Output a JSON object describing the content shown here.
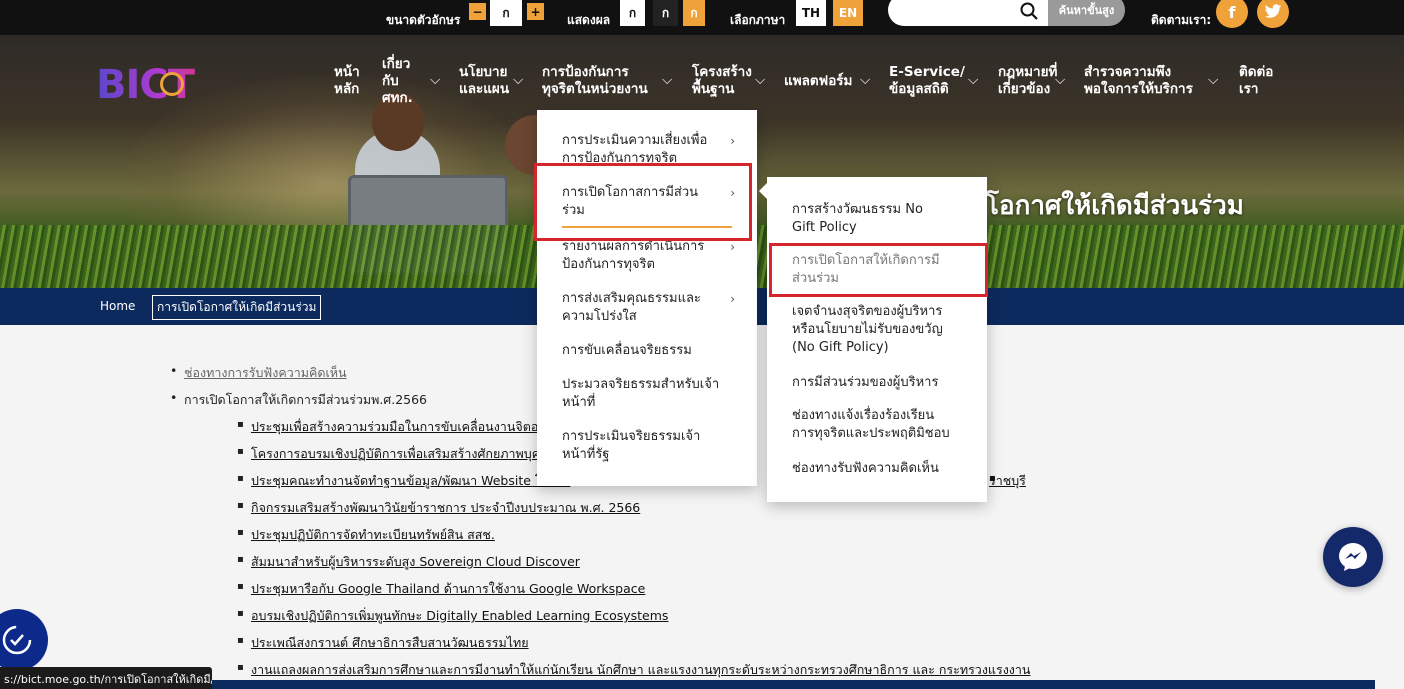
{
  "topbar": {
    "font_size_label": "ขนาดตัวอักษร",
    "font_minus": "−",
    "font_normal": "ก",
    "font_plus": "+",
    "display_label": "แสดงผล",
    "display_options": [
      "ก",
      "ก",
      "ก"
    ],
    "language_label": "เลือกภาษา",
    "lang_th": "TH",
    "lang_en": "EN",
    "search_placeholder": "",
    "advanced_search": "ค้นหาขั้นสูง",
    "follow_label": "ติดตามเรา:"
  },
  "logo": {
    "text": "BICT"
  },
  "nav": {
    "home": [
      "หน้า",
      "หลัก"
    ],
    "about": [
      "เกี่ยว",
      "กับ",
      "ศทก."
    ],
    "policy": [
      "นโยบาย",
      "และแผน"
    ],
    "anticorruption": [
      "การป้องกันการ",
      "ทุจริตในหน่วยงาน"
    ],
    "infrastructure": [
      "โครงสร้าง",
      "พื้นฐาน"
    ],
    "platform": [
      "แพลตฟอร์ม"
    ],
    "eservice": [
      "E-Service/",
      "ข้อมูลสถิติ"
    ],
    "law": [
      "กฎหมายที่",
      "เกี่ยวข้อง"
    ],
    "survey": [
      "สำรวจความพึง",
      "พอใจการให้บริการ"
    ],
    "contact": [
      "ติดต่อ",
      "เรา"
    ]
  },
  "hero": {
    "title": "โอกาศให้เกิดมีส่วนร่วม"
  },
  "breadcrumb": {
    "home": "Home",
    "current": "การเปิดโอกาศให้เกิดมีส่วนร่วม"
  },
  "dropdown1": {
    "items": [
      [
        "การประเมินความเสี่ยงเพื่อ",
        "การป้องกันการทุจริต"
      ],
      [
        "การเปิดโอกาสการมีส่วน",
        "ร่วม"
      ],
      [
        "รายงานผลการดำเนินการ",
        "ป้องกันการทุจริต"
      ],
      [
        "การส่งเสริมคุณธรรมและ",
        "ความโปร่งใส"
      ],
      [
        "การขับเคลื่อนจริยธรรม"
      ],
      [
        "ประมวลจริยธรรมสำหรับเจ้า",
        "หน้าที่"
      ],
      [
        "การประเมินจริยธรรมเจ้า",
        "หน้าที่รัฐ"
      ]
    ]
  },
  "dropdown2": {
    "items": [
      [
        "การสร้างวัฒนธรรม No",
        "Gift Policy"
      ],
      [
        "การเปิดโอกาสให้เกิดการมี",
        "ส่วนร่วม"
      ],
      [
        "เจตจำนงสุจริตของผู้บริหาร",
        "หรือนโยบายไม่รับของขวัญ",
        "(No Gift Policy)"
      ],
      [
        "การมีส่วนร่วมของผู้บริหาร"
      ],
      [
        "ช่องทางแจ้งเรื่องร้องเรียน",
        "การทุจริตและประพฤติมิชอบ"
      ],
      [
        "ช่องทางรับฟังความคิดเห็น"
      ]
    ]
  },
  "content": {
    "top_items": [
      "ช่องทางการรับฟังความคิดเห็น",
      "การเปิดโอกาสให้เกิดการมีส่วนร่วมพ.ศ.2566"
    ],
    "sub_items": [
      "ประชุมเพื่อสร้างความร่วมมือในการขับเคลื่อนงานจิตอาสา ก",
      "โครงการอบรมเชิงปฏิบัติการเพื่อเสริมสร้างศักยภาพบุคลากร",
      "ประชุมคณะทำงานจัดทำฐานข้อมูล/พัฒนา Website โครงก",
      "กิจกรรมเสริมสร้างพัฒนาวินัยข้าราชการ ประจำปีงบประมาณ พ.ศ. 2566",
      "ประชุมปฏิบัติการจัดทำทะเบียนทรัพย์สิน สสช.",
      "สัมมนาสำหรับผู้บริหารระดับสูง Sovereign Cloud Discover",
      "ประชุมหารือกับ Google Thailand ด้านการใช้งาน Google Workspace",
      "อบรมเชิงปฏิบัติการเพิ่มพูนทักษะ Digitally Enabled Learning Ecosystems",
      "ประเพณีสงกรานต์ ศึกษาธิการสืบสานวัฒนธรรมไทย",
      "งานแถลงผลการส่งเสริมการศึกษาและการมีงานทำให้แก่นักเรียน นักศึกษา และแรงงานทุกระดับระหว่างกระทรวงศึกษาธิการ และ กระทรวงแรงงาน"
    ],
    "sub_item_tail": "ราชบุรี"
  },
  "statusbar": {
    "url": "s://bict.moe.go.th/การเปิดโอกาสให้เกิดมี/"
  }
}
